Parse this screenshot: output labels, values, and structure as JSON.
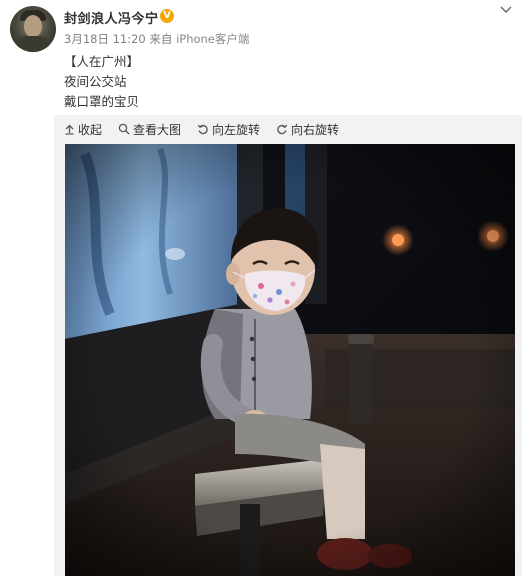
{
  "post": {
    "username": "封剑浪人冯今宁",
    "verified_badge": "V",
    "date": "3月18日 11:20",
    "source_prefix": "来自",
    "source": "iPhone客户端",
    "lines": [
      "【人在广州】",
      "夜间公交站",
      "戴口罩的宝贝"
    ]
  },
  "toolbar": {
    "collapse": "收起",
    "view_large": "查看大图",
    "rotate_left": "向左旋转",
    "rotate_right": "向右旋转"
  },
  "icons": {
    "verified": "verified-badge-icon",
    "menu": "chevron-down-icon",
    "collapse": "arrow-up-icon",
    "view_large": "magnifier-icon",
    "rotate_left": "rotate-left-icon",
    "rotate_right": "rotate-right-icon"
  },
  "colors": {
    "username": "#333333",
    "meta": "#808080",
    "verified_badge": "#f7a701",
    "media_panel_bg": "#f2f2f5"
  }
}
